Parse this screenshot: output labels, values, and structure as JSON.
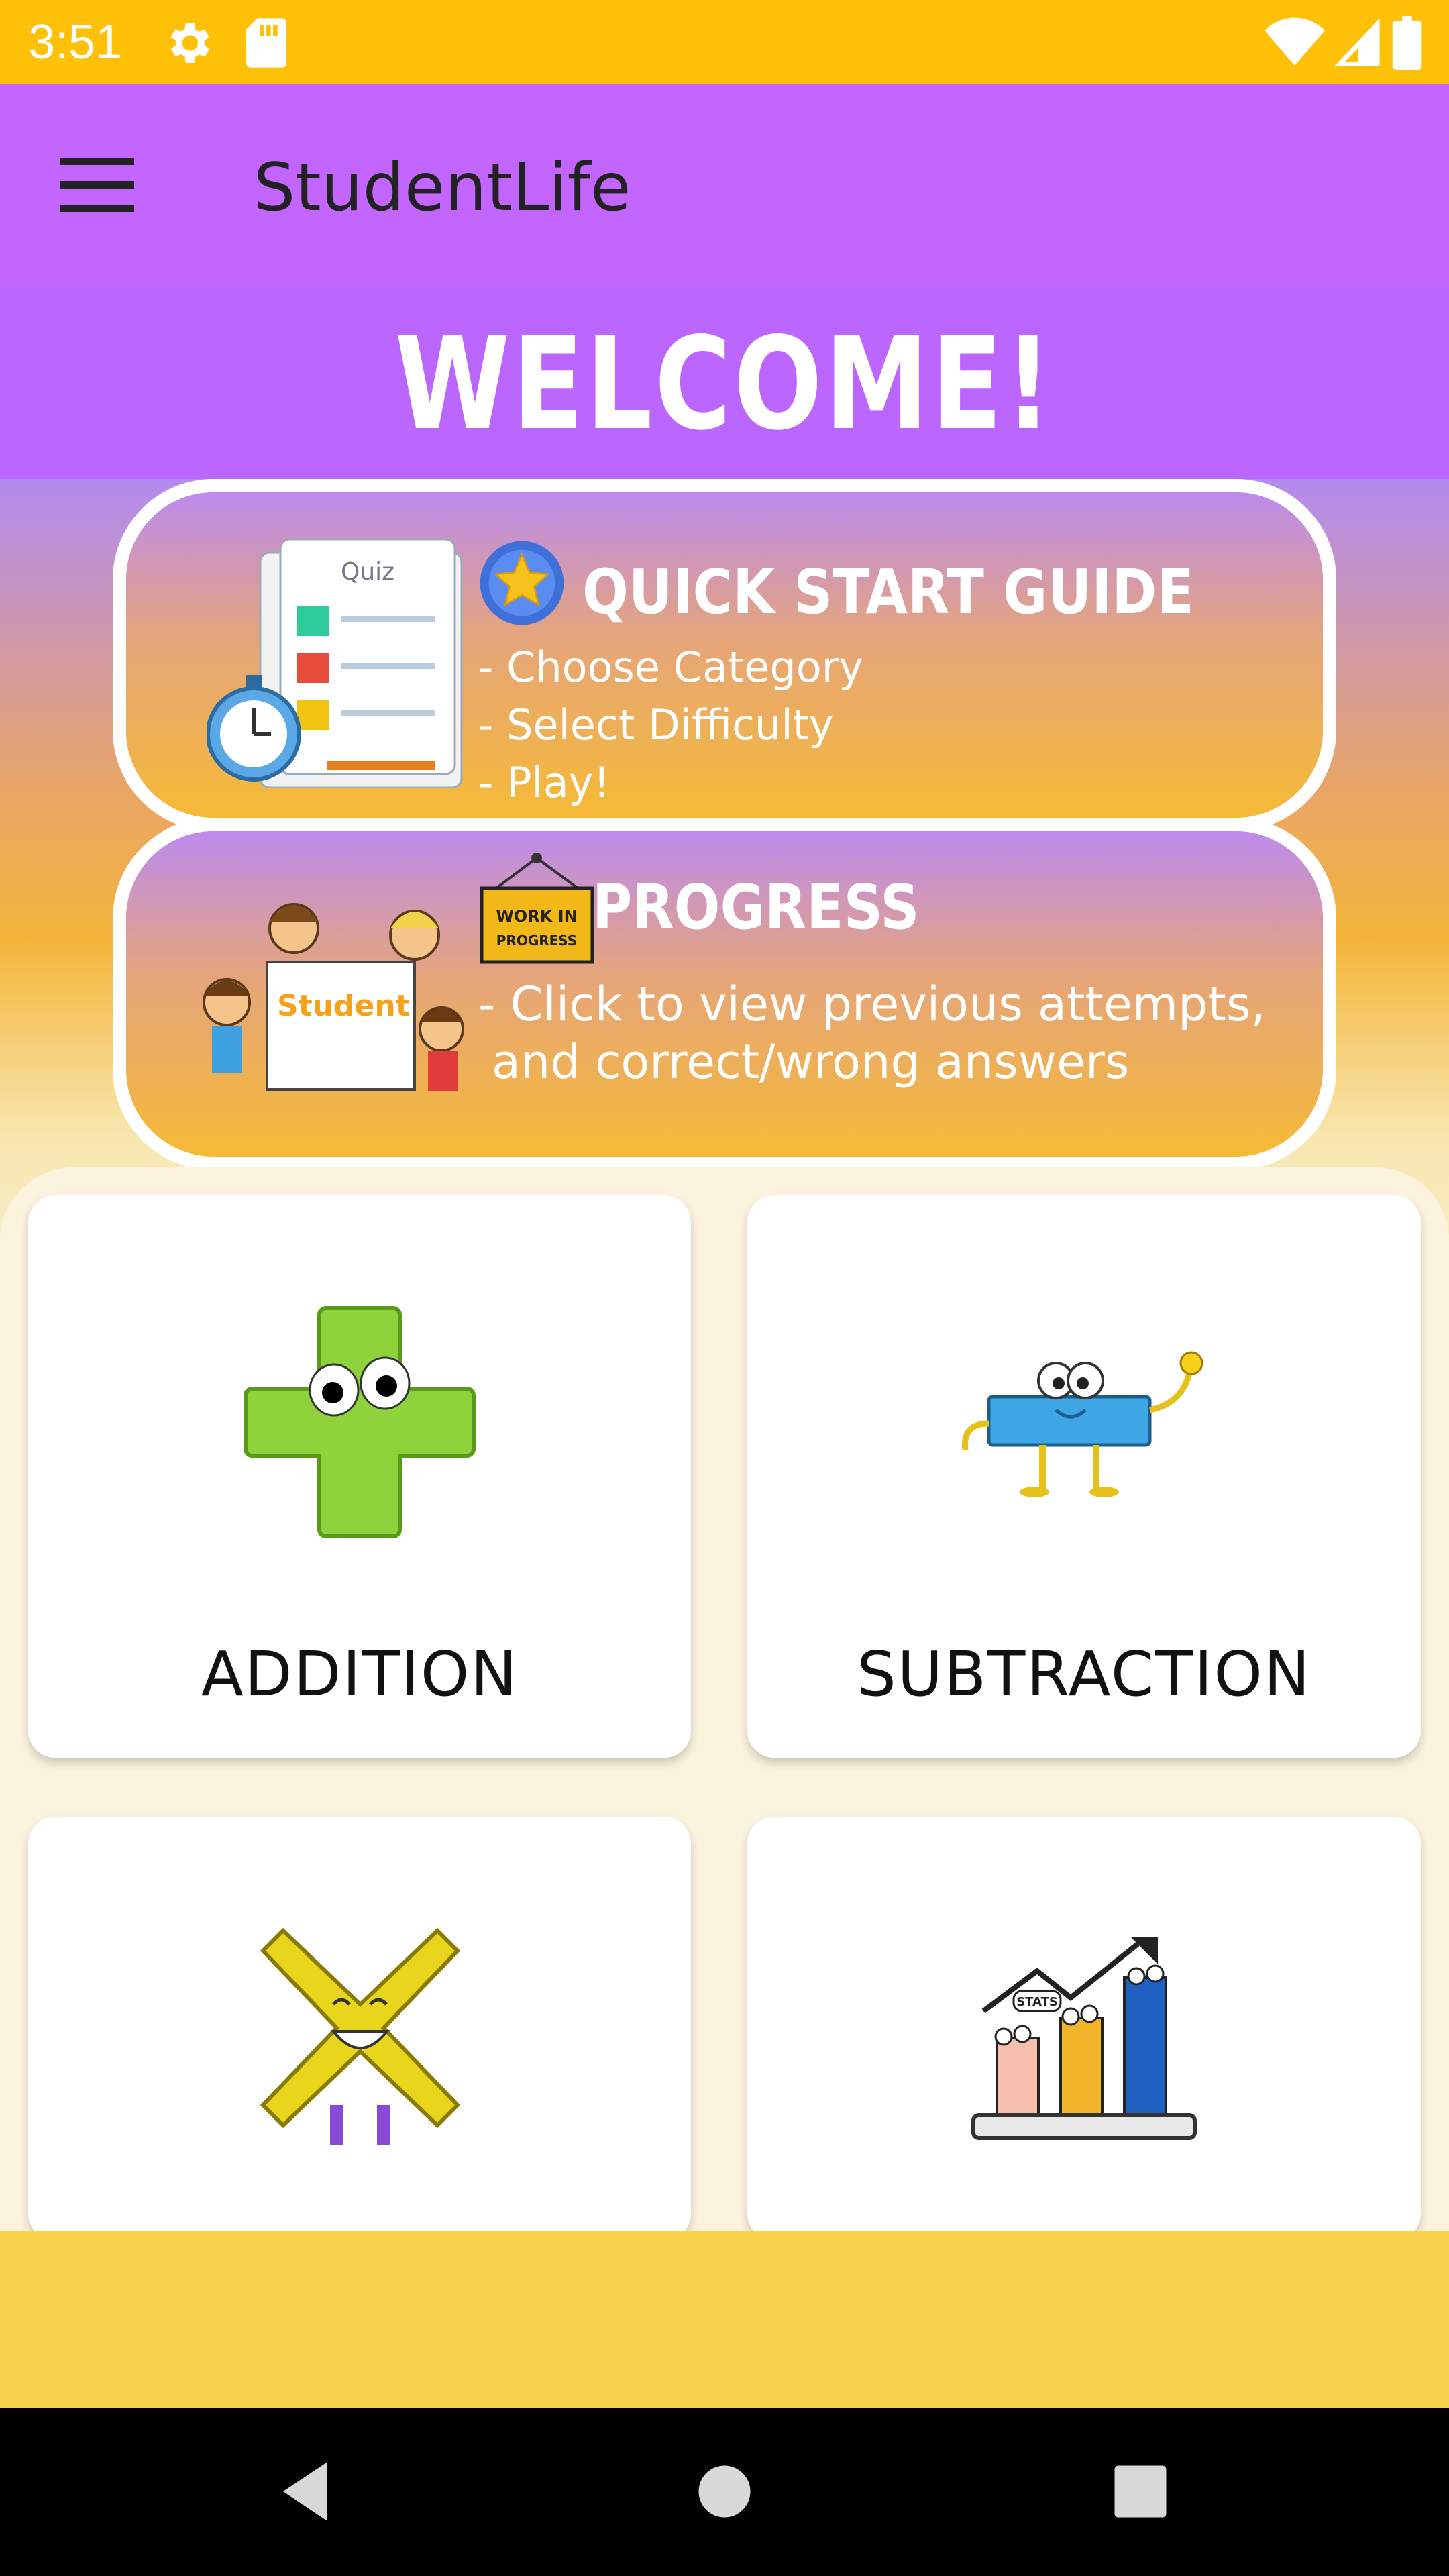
{
  "status_bar": {
    "time": "3:51",
    "icons": [
      "gear-icon",
      "sd-card-icon",
      "wifi-icon",
      "signal-icon",
      "battery-icon"
    ]
  },
  "app_bar": {
    "title": "StudentLife",
    "menu_icon": "hamburger-menu-icon"
  },
  "welcome": "WELCOME!",
  "quick_start": {
    "title": "QUICK START GUIDE",
    "lines": [
      "- Choose Category",
      "- Select Difficulty",
      "- Play!"
    ],
    "image_label": "Quiz"
  },
  "progress": {
    "title": "PROGRESS",
    "lines": [
      "- Click to view previous attempts,",
      "and correct/wrong answers"
    ],
    "sign_text": "WORK IN PROGRESS",
    "image_label": "Student"
  },
  "categories": [
    {
      "label": "ADDITION",
      "icon": "plus-character-icon"
    },
    {
      "label": "SUBTRACTION",
      "icon": "minus-character-icon"
    },
    {
      "label": "",
      "icon": "multiply-character-icon"
    },
    {
      "label": "",
      "icon": "stats-chart-icon"
    }
  ],
  "stats_tag": "STATS",
  "colors": {
    "status_bar": "#FFC107",
    "app_bar": "#C266FF",
    "welcome_band": "#BB66FF",
    "bottom_strip": "#F9D34B"
  },
  "nav": [
    "back-button",
    "home-button",
    "recents-button"
  ]
}
